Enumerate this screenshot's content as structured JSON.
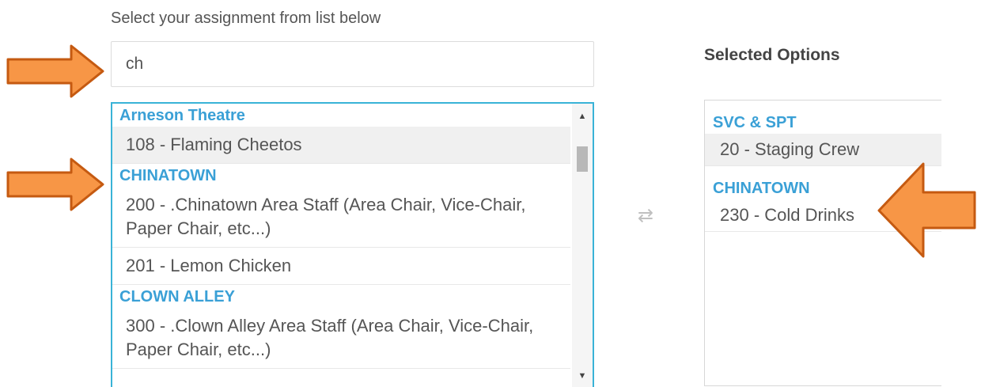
{
  "instruction": "Select your assignment from list below",
  "search": {
    "value": "ch"
  },
  "available": {
    "groups": [
      {
        "header": "Arneson Theatre",
        "options": [
          "108 - Flaming Cheetos"
        ]
      },
      {
        "header": "CHINATOWN",
        "options": [
          "200 - .Chinatown Area Staff (Area Chair, Vice-Chair, Paper Chair, etc...)",
          "201 - Lemon Chicken"
        ]
      },
      {
        "header": "CLOWN ALLEY",
        "options": [
          "300 - .Clown Alley Area Staff (Area Chair, Vice-Chair, Paper Chair, etc...)"
        ]
      }
    ]
  },
  "transfer_icon": "⇄",
  "selected": {
    "title": "Selected Options",
    "groups": [
      {
        "header": "SVC & SPT",
        "options": [
          "20 - Staging Crew"
        ]
      },
      {
        "header": "CHINATOWN",
        "options": [
          "230 - Cold Drinks"
        ]
      }
    ]
  },
  "annotations": {
    "arrow_color": "#f79646",
    "arrow_border": "#c55a11"
  },
  "icons": [
    "scroll-up-icon",
    "scroll-down-icon",
    "transfer-icon",
    "annotation-arrow"
  ]
}
